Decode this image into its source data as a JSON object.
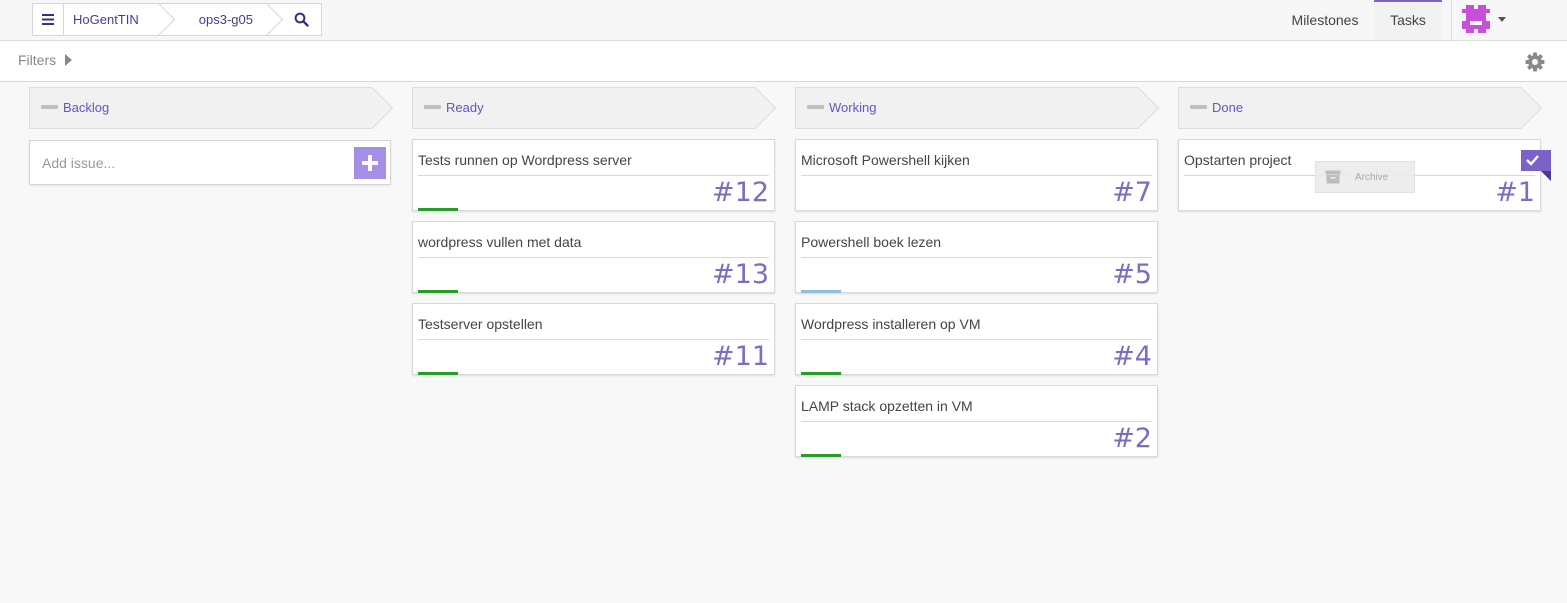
{
  "topbar": {
    "org": "HoGentTIN",
    "repo": "ops3-g05",
    "nav": {
      "milestones": "Milestones",
      "tasks": "Tasks"
    }
  },
  "filters": {
    "label": "Filters"
  },
  "colors": {
    "accent": "#6b52c2",
    "bar_green": "#2a9a2a",
    "bar_blue": "#8fbde6",
    "add_button": "#a58ee6"
  },
  "columns": [
    {
      "title": "Backlog",
      "add_issue": {
        "placeholder": "Add issue..."
      },
      "cards": []
    },
    {
      "title": "Ready",
      "cards": [
        {
          "title": "Tests runnen op Wordpress server",
          "number": "#12",
          "bar": "green"
        },
        {
          "title": "wordpress vullen met data",
          "number": "#13",
          "bar": "green"
        },
        {
          "title": "Testserver opstellen",
          "number": "#11",
          "bar": "green"
        }
      ]
    },
    {
      "title": "Working",
      "cards": [
        {
          "title": "Microsoft Powershell kijken",
          "number": "#7",
          "bar": "none"
        },
        {
          "title": "Powershell boek lezen",
          "number": "#5",
          "bar": "blue"
        },
        {
          "title": "Wordpress installeren op VM",
          "number": "#4",
          "bar": "green"
        },
        {
          "title": "LAMP stack opzetten in VM",
          "number": "#2",
          "bar": "green"
        }
      ]
    },
    {
      "title": "Done",
      "cards": [
        {
          "title": "Opstarten project",
          "number": "#1",
          "bar": "none",
          "archive_label": "Archive"
        }
      ]
    }
  ]
}
